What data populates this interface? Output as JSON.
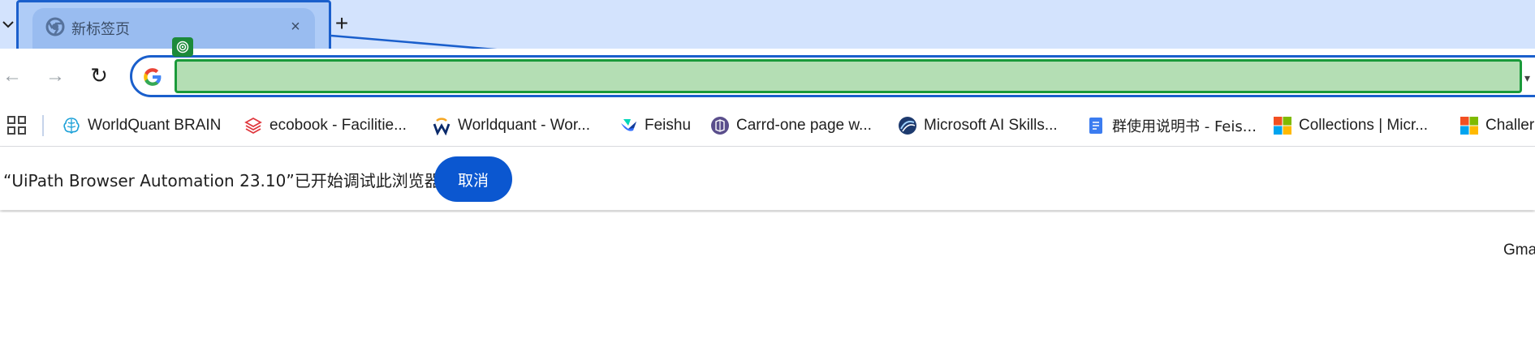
{
  "tabs": {
    "active": {
      "title": "新标签页",
      "close": "×"
    },
    "new_tab": "+"
  },
  "toolbar": {
    "back": "←",
    "forward": "→",
    "reload": "↻",
    "omnibox_value": ""
  },
  "bookmarks": [
    {
      "label": "WorldQuant BRAIN",
      "icon": "brain-icon"
    },
    {
      "label": "ecobook - Facilitie...",
      "icon": "ecobook-icon"
    },
    {
      "label": "Worldquant - Wor...",
      "icon": "workday-icon"
    },
    {
      "label": "Feishu",
      "icon": "feishu-icon"
    },
    {
      "label": "Carrd-one page w...",
      "icon": "carrd-icon"
    },
    {
      "label": "Microsoft AI Skills...",
      "icon": "microsoft-ai-icon"
    },
    {
      "label": "群使用说明书 - Feis...",
      "icon": "doc-icon"
    },
    {
      "label": "Collections | Micr...",
      "icon": "microsoft-logo-icon"
    },
    {
      "label": "Challer",
      "icon": "microsoft-logo-icon"
    }
  ],
  "infobar": {
    "message": "“UiPath Browser Automation 23.10”已开始调试此浏览器",
    "cancel": "取消"
  },
  "page": {
    "gmail": "Gma"
  },
  "colors": {
    "tabstrip": "#d3e3fd",
    "active_tab": "#b1cbf3",
    "highlight_border": "#1a5fcc",
    "input_highlight": "#b4deb4",
    "input_border": "#1a9a3a",
    "cancel_button": "#0b57d0"
  }
}
